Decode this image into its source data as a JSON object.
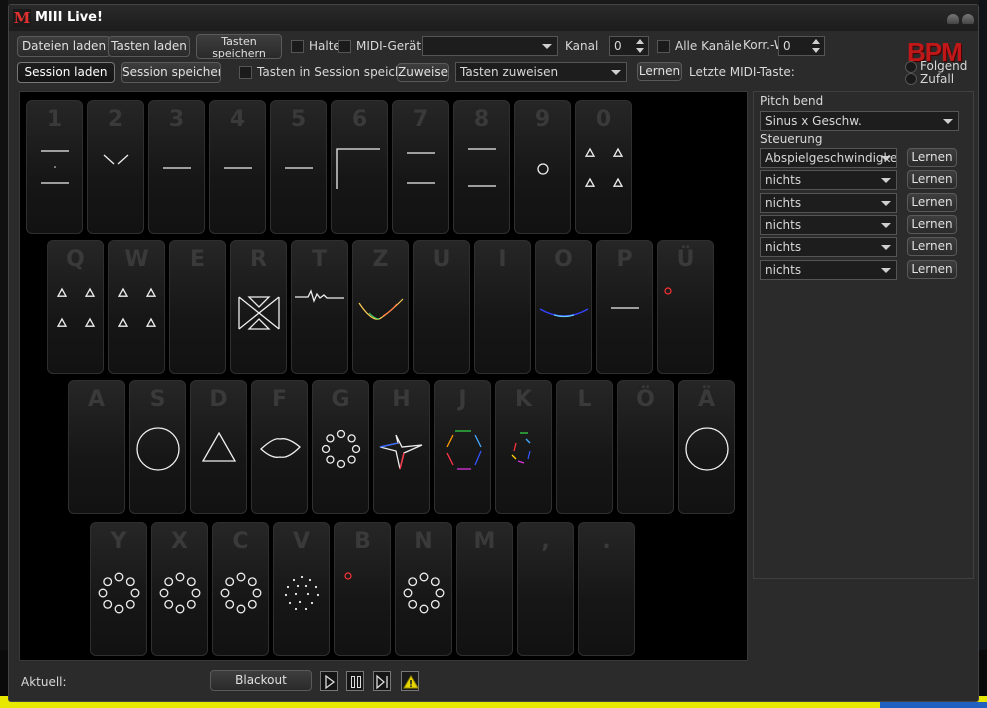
{
  "window": {
    "title": "MIII Live!",
    "logo": "M"
  },
  "toolbar": {
    "dateien_laden": "Dateien laden",
    "tasten_laden": "Tasten laden",
    "tasten_speichern": "Tasten speichern",
    "halte": "Halte",
    "midi_geraet": "MIDI-Gerät",
    "midi_geraet_value": "",
    "kanal": "Kanal",
    "kanal_value": "0",
    "alle_kanaele": "Alle Kanäle",
    "korr": "Korr.-W",
    "korr_value": "0",
    "session_laden": "Session laden",
    "session_speichern": "Session speichern",
    "tasten_in_session": "Tasten in Session speichern",
    "zuweisen": "Zuweisen",
    "tasten_zuweisen": "Tasten zuweisen",
    "lernen": "Lernen",
    "letzte_midi": "Letzte MIDI-Taste:",
    "bpm_logo": "BPM",
    "folgend": "Folgend",
    "zufall": "Zufall"
  },
  "keyboard": {
    "rows": [
      [
        "1",
        "2",
        "3",
        "4",
        "5",
        "6",
        "7",
        "8",
        "9",
        "0"
      ],
      [
        "Q",
        "W",
        "E",
        "R",
        "T",
        "Z",
        "U",
        "I",
        "O",
        "P",
        "Ü"
      ],
      [
        "A",
        "S",
        "D",
        "F",
        "G",
        "H",
        "J",
        "K",
        "L",
        "Ö",
        "Ä"
      ],
      [
        "Y",
        "X",
        "C",
        "V",
        "B",
        "N",
        "M",
        ",",
        "."
      ]
    ]
  },
  "panel": {
    "pitch_bend_label": "Pitch bend",
    "pitch_bend_value": "Sinus x Geschw.",
    "steuerung_label": "Steuerung",
    "controls": [
      {
        "value": "Abspielgeschwindigkeit",
        "button": "Lernen"
      },
      {
        "value": "nichts",
        "button": "Lernen"
      },
      {
        "value": "nichts",
        "button": "Lernen"
      },
      {
        "value": "nichts",
        "button": "Lernen"
      },
      {
        "value": "nichts",
        "button": "Lernen"
      },
      {
        "value": "nichts",
        "button": "Lernen"
      }
    ]
  },
  "bottom": {
    "aktuell": "Aktuell:",
    "blackout": "Blackout"
  },
  "colors": {
    "accent_red": "#c01818",
    "highlight_yellow": "#e8e800"
  }
}
